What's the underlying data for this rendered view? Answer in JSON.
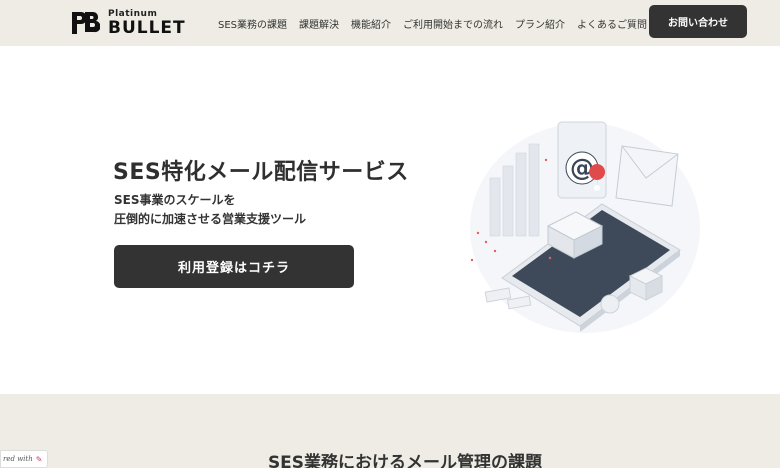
{
  "brand": {
    "mark": "PB",
    "small": "Platinum",
    "big": "BULLET"
  },
  "nav": {
    "items": [
      {
        "label": "SES業務の課題"
      },
      {
        "label": "課題解決"
      },
      {
        "label": "機能紹介"
      },
      {
        "label": "ご利用開始までの流れ"
      },
      {
        "label": "プラン紹介"
      },
      {
        "label": "よくあるご質問"
      }
    ],
    "contact_label": "お問い合わせ"
  },
  "hero": {
    "title": "SES特化メール配信サービス",
    "subtitle_line1": "SES事業のスケールを",
    "subtitle_line2": "圧倒的に加速させる営業支援ツール",
    "cta_label": "利用登録はコチラ",
    "illustration_icon": "at-sign-email-phone-icon",
    "illustration_at": "@"
  },
  "section2": {
    "title": "SES業務におけるメール管理の課題"
  },
  "badge": {
    "text": "red with",
    "icon": "pen-icon"
  },
  "colors": {
    "header_bg": "#eeece4",
    "button_dark": "#333333",
    "text": "#2b2b2b",
    "accent_pin": "#e04a4a"
  }
}
